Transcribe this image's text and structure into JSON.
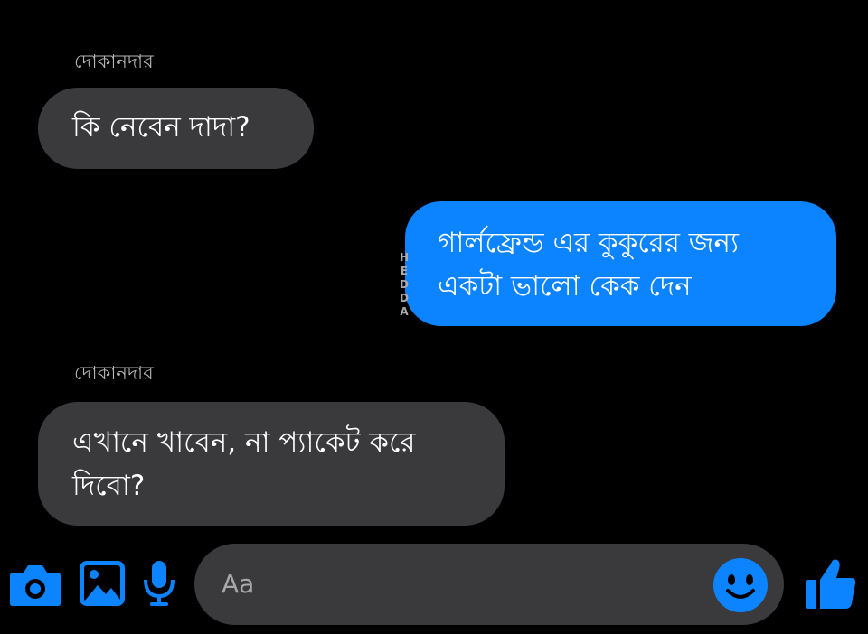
{
  "messages": [
    {
      "sender": "দোকানদার",
      "text": "কি নেবেন দাদা?",
      "direction": "incoming"
    },
    {
      "sender": "",
      "lines": [
        "গার্লফ্রেন্ড এর কুকুরের জন্য",
        "একটা ভালো কেক দেন"
      ],
      "direction": "outgoing"
    },
    {
      "sender": "দোকানদার",
      "lines": [
        "এখানে খাবেন, না প্যাকেট করে",
        "দিবো?"
      ],
      "direction": "incoming"
    }
  ],
  "watermark": [
    "H",
    "E",
    "D",
    "D",
    "A"
  ],
  "composer": {
    "placeholder": "Aa",
    "icons": [
      "camera-icon",
      "image-icon",
      "microphone-icon",
      "emoji-icon",
      "thumbs-up-icon"
    ]
  },
  "colors": {
    "background": "#000000",
    "incoming_bubble": "#3a3a3c",
    "outgoing_bubble": "#0d84ff",
    "accent": "#0d84ff"
  }
}
